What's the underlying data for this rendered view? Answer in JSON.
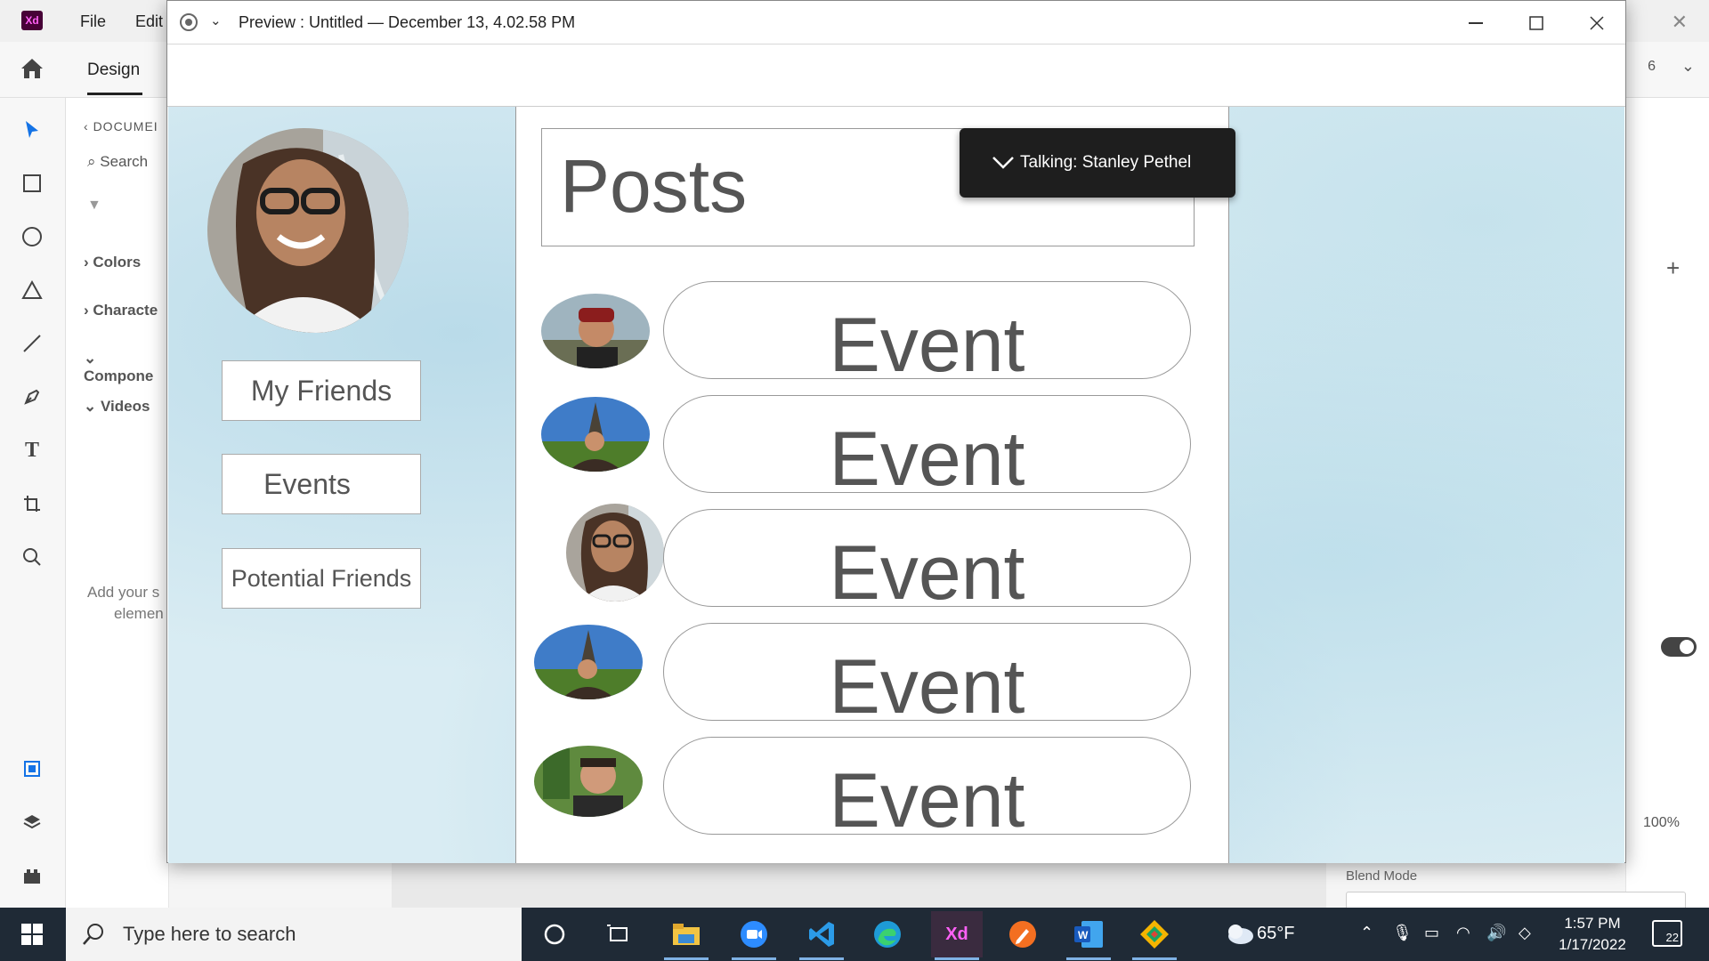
{
  "xd": {
    "logo": "Xd",
    "menu": [
      "File",
      "Edit"
    ],
    "design_tab": "Design",
    "left_panel": {
      "document": "DOCUMEI",
      "search": "Search",
      "sections": [
        "Colors",
        "Characte",
        "Compone",
        "Videos"
      ],
      "hint_line1": "Add your s",
      "hint_line2": "elemen"
    },
    "right_panel": {
      "zoom_fragment": "6",
      "percent": "100%",
      "blend_mode": "Blend Mode"
    }
  },
  "preview": {
    "title": "Preview : Untitled — December 13, 4.02.58 PM",
    "talking": "Talking: Stanley Pethel",
    "nav": [
      "My Friends",
      "Events",
      "Potential Friends"
    ],
    "posts_title": "Posts",
    "posts": [
      {
        "label": "Event"
      },
      {
        "label": "Event"
      },
      {
        "label": "Event"
      },
      {
        "label": "Event"
      },
      {
        "label": "Event"
      }
    ]
  },
  "taskbar": {
    "search_placeholder": "Type here to search",
    "temperature": "65°F",
    "time": "1:57 PM",
    "date": "1/17/2022",
    "notifications": "22"
  },
  "colors": {
    "xd_brand": "#470137",
    "taskbar": "#1f2a36",
    "talking_bg": "#1e1e1e",
    "artboard_bg": "#d9ecf3"
  }
}
